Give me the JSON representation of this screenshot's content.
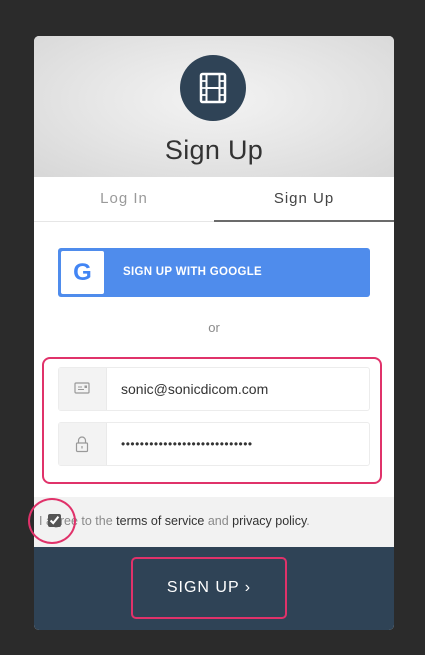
{
  "header": {
    "title": "Sign Up",
    "logo_icon": "film-icon"
  },
  "tabs": [
    {
      "label": "Log In",
      "active": false
    },
    {
      "label": "Sign Up",
      "active": true
    }
  ],
  "social": {
    "google_label": "SIGN UP WITH GOOGLE",
    "google_letter": "G"
  },
  "divider": {
    "or_label": "or"
  },
  "form": {
    "email_value": "sonic@sonicdicom.com",
    "password_value": "••••••••••••••••••••••••••••"
  },
  "terms": {
    "checked": true,
    "prefix": "I agree to the ",
    "tos_label": "terms of service",
    "middle": " and ",
    "privacy_label": "privacy policy",
    "suffix": "."
  },
  "footer": {
    "signup_label": "SIGN UP ›"
  },
  "colors": {
    "accent": "#2f4356",
    "google": "#4f8cec",
    "highlight": "#e0326a"
  }
}
